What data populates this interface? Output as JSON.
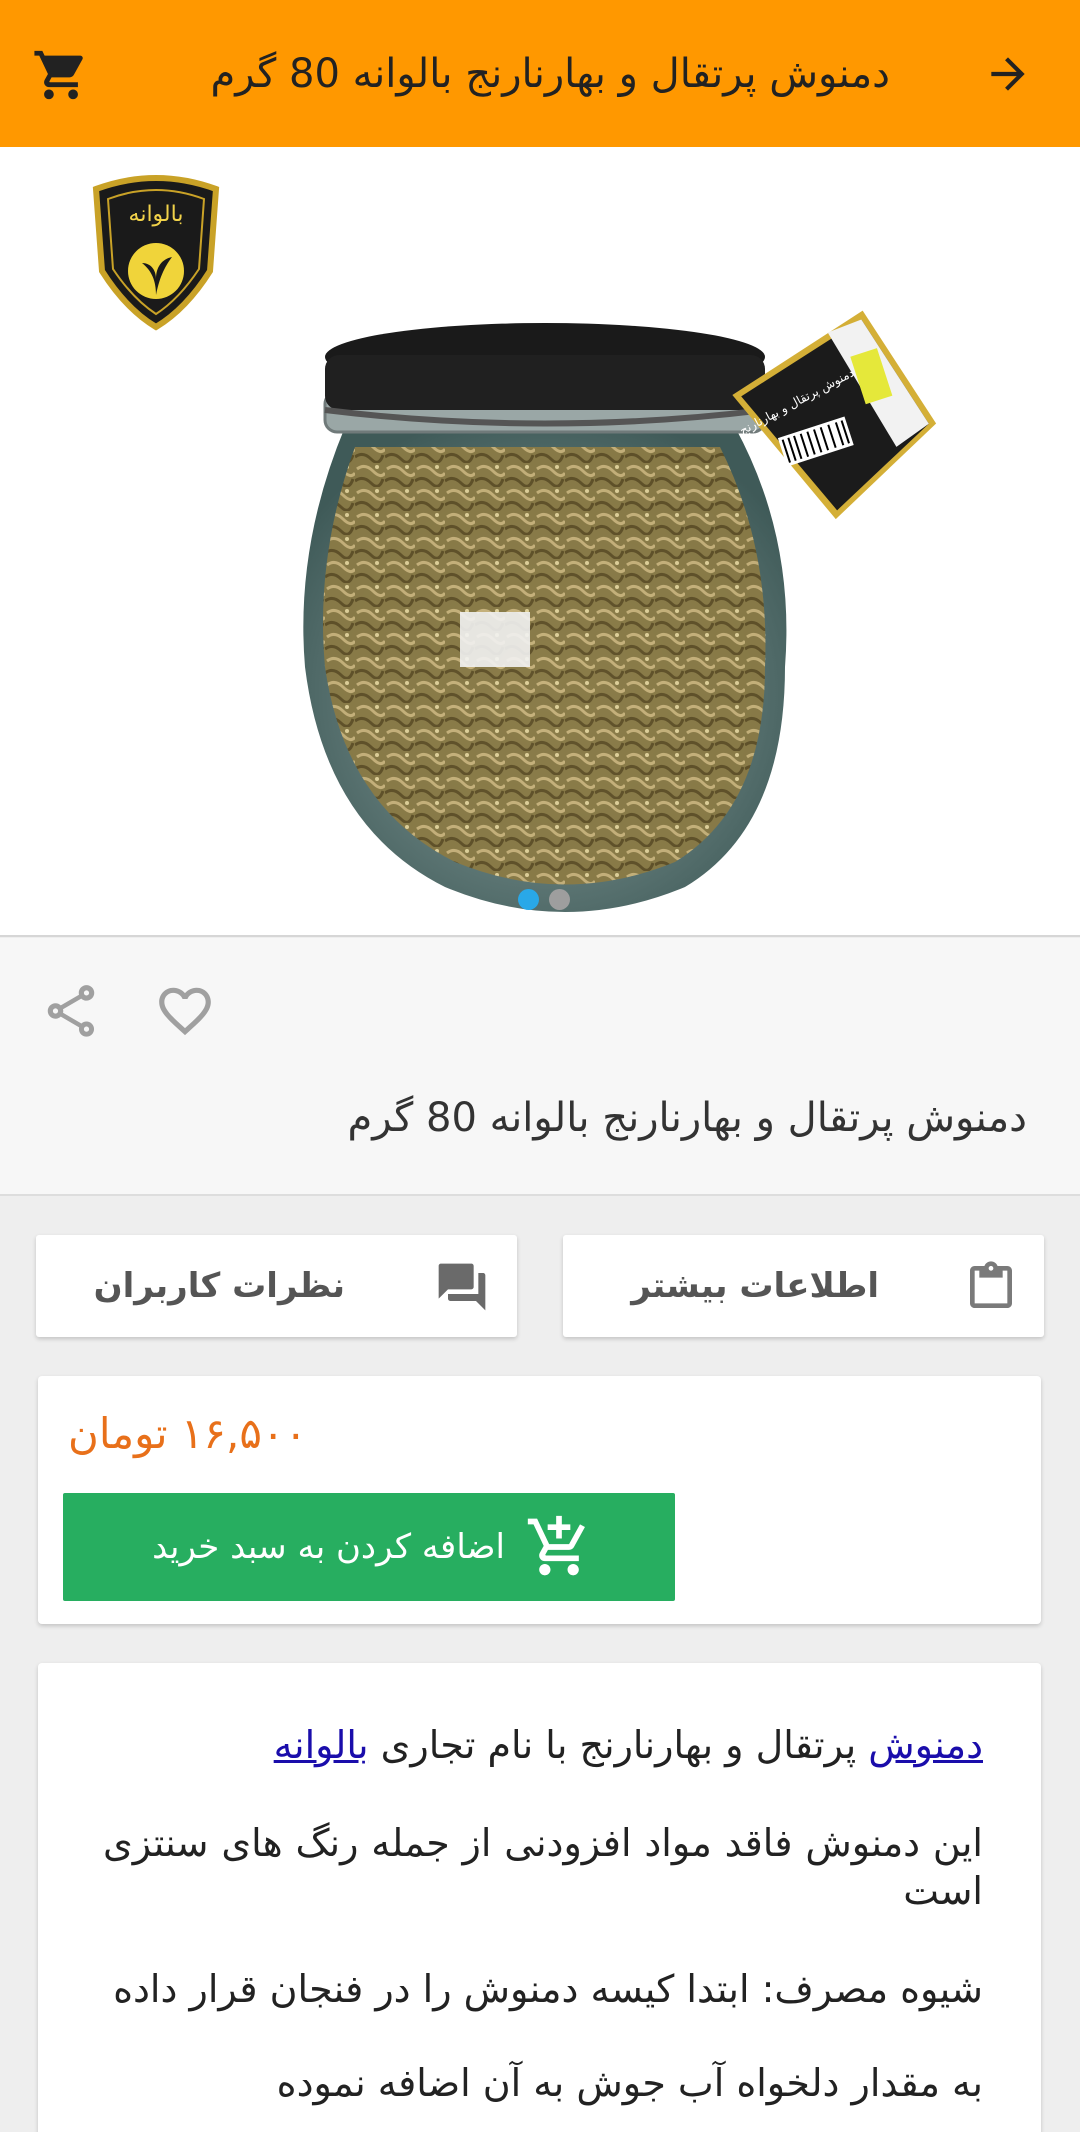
{
  "appbar": {
    "title": "دمنوش پرتقال و بهارنارنج بالوانه 80 گرم",
    "back_icon": "arrow-forward-icon",
    "cart_icon": "cart-icon",
    "background": "#ff9800"
  },
  "gallery": {
    "brand_logo_text": "بالوانه",
    "jar_label_text": "دمنوش پرتقال و بهارنارنج",
    "slide_count": 2,
    "active_slide": 1,
    "active_dot_color": "#29a8e8"
  },
  "product": {
    "name": "دمنوش پرتقال و بهارنارنج بالوانه 80 گرم",
    "share_icon": "share-icon",
    "favorite_icon": "heart-outline-icon"
  },
  "tabs": {
    "more_info": "اطلاعات بیشتر",
    "reviews": "نظرات کاربران"
  },
  "purchase": {
    "price": "۱۶,۵۰۰ تومان",
    "add_to_cart": "اضافه کردن به سبد خرید",
    "button_color": "#27ae60",
    "price_color": "#e8701a"
  },
  "description": {
    "line1_link1": "دمنوش",
    "line1_middle": " پرتقال و بهارنارنج با نام تجاری ",
    "line1_link2": "بالوانه",
    "para2": "این دمنوش فاقد مواد افزودنی از جمله رنگ های سنتزی است",
    "para3": "شیوه مصرف: ابتدا کیسه دمنوش را در فنجان قرار داده",
    "para4": "به مقدار دلخواه آب جوش به آن اضافه نموده"
  }
}
